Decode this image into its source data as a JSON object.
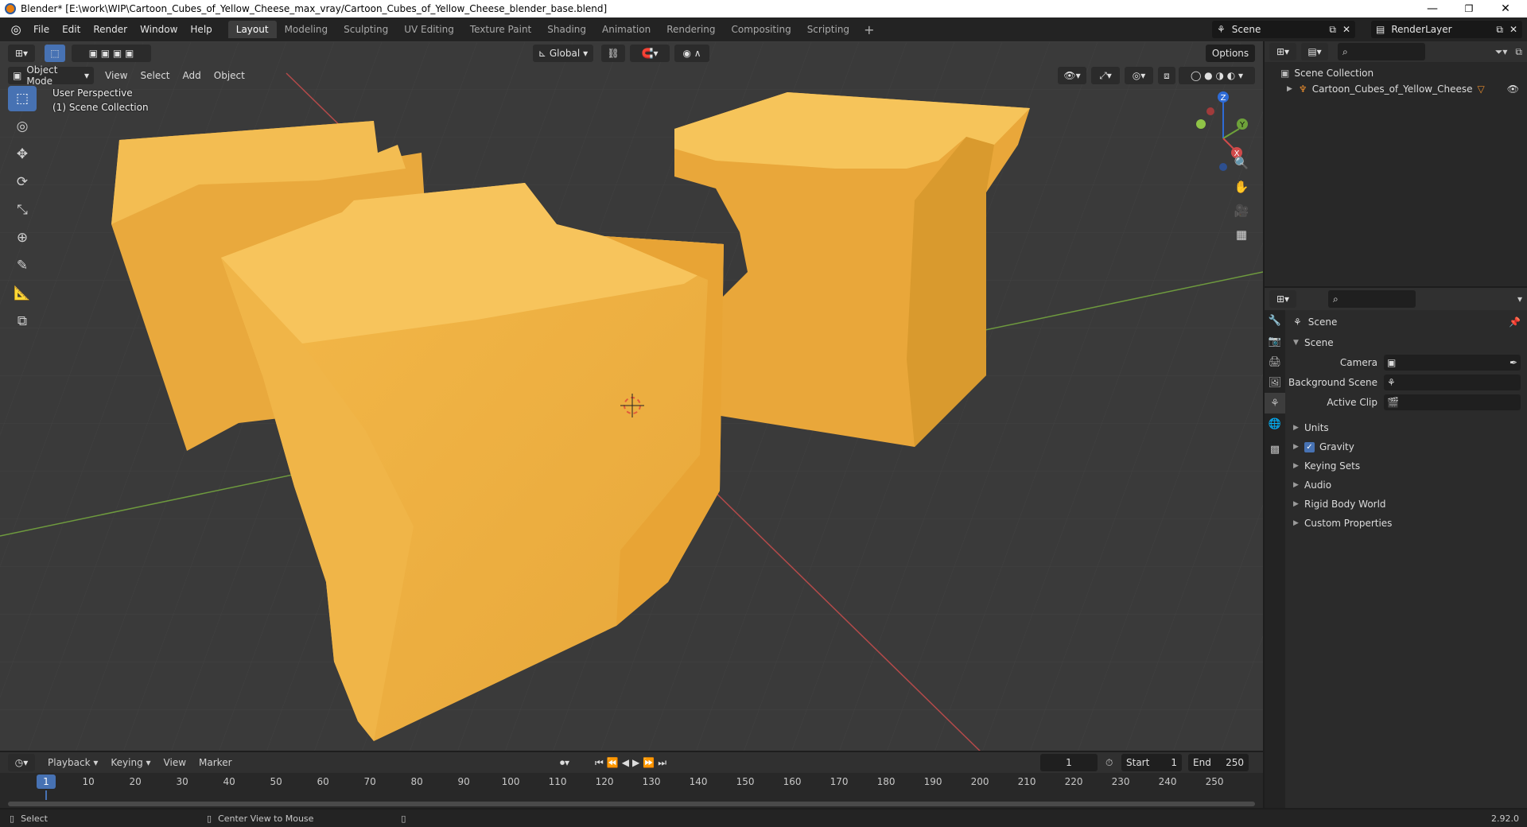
{
  "window": {
    "title": "Blender* [E:\\work\\WIP\\Cartoon_Cubes_of_Yellow_Cheese_max_vray/Cartoon_Cubes_of_Yellow_Cheese_blender_base.blend]",
    "minimize": "—",
    "maximize": "❐",
    "close": "✕"
  },
  "topbar": {
    "menus": [
      "File",
      "Edit",
      "Render",
      "Window",
      "Help"
    ],
    "workspaces": [
      "Layout",
      "Modeling",
      "Sculpting",
      "UV Editing",
      "Texture Paint",
      "Shading",
      "Animation",
      "Rendering",
      "Compositing",
      "Scripting"
    ],
    "active_workspace": "Layout",
    "add_workspace": "+",
    "scene_name": "Scene",
    "view_layer": "RenderLayer"
  },
  "viewport": {
    "mode": "Object Mode",
    "menus": [
      "View",
      "Select",
      "Add",
      "Object"
    ],
    "transform_orientation": "Global",
    "options_label": "Options",
    "perspective_label": "User Perspective",
    "collection_label": "(1) Scene Collection",
    "gizmo": {
      "x": "X",
      "y": "Y",
      "z": "Z"
    },
    "object_color": "#f2b642"
  },
  "outliner": {
    "root": "Scene Collection",
    "items": [
      {
        "name": "Cartoon_Cubes_of_Yellow_Cheese"
      }
    ]
  },
  "properties": {
    "context": "Scene",
    "panel_title": "Scene",
    "fields": [
      {
        "label": "Camera",
        "value": ""
      },
      {
        "label": "Background Scene",
        "value": ""
      },
      {
        "label": "Active Clip",
        "value": ""
      }
    ],
    "collapsed_panels": [
      "Units",
      "Gravity",
      "Keying Sets",
      "Audio",
      "Rigid Body World",
      "Custom Properties"
    ],
    "gravity_checked": true
  },
  "timeline": {
    "menus": [
      "Playback",
      "Keying",
      "View",
      "Marker"
    ],
    "current_frame": "1",
    "start_label": "Start",
    "start": "1",
    "end_label": "End",
    "end": "250",
    "ticks": [
      "10",
      "20",
      "30",
      "40",
      "50",
      "60",
      "70",
      "80",
      "90",
      "100",
      "110",
      "120",
      "130",
      "140",
      "150",
      "160",
      "170",
      "180",
      "190",
      "200",
      "210",
      "220",
      "230",
      "240",
      "250"
    ],
    "frame_badge": "1"
  },
  "statusbar": {
    "left": "Select",
    "middle": "Center View to Mouse",
    "version": "2.92.0"
  }
}
